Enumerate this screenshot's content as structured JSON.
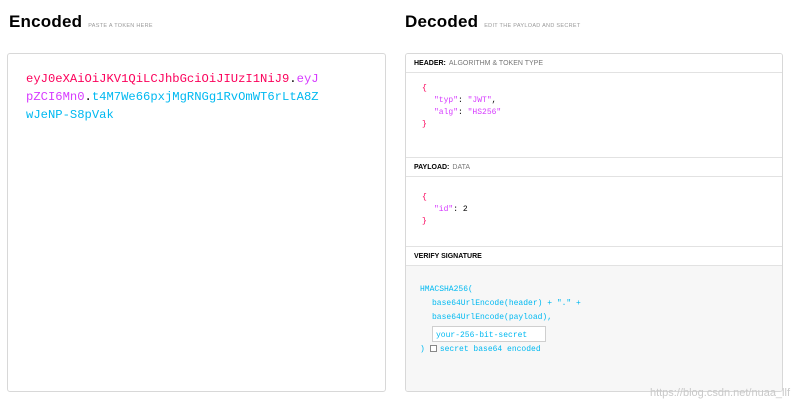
{
  "encoded": {
    "title": "Encoded",
    "subtitle": "PASTE A TOKEN HERE",
    "token_line1_header": "eyJ0eXAiOiJKV1QiLCJhbGciOiJIUzI1NiJ9",
    "token_line1_dot": ".",
    "token_line1_payload": "eyJ",
    "token_line2_payload": "pZCI6Mn0",
    "token_line2_dot": ".",
    "token_line2_sig": "t4M7We66pxjMgRNGg1RvOmWT6rLtA8Z",
    "token_line3_sig": "wJeNP-S8pVak"
  },
  "decoded": {
    "title": "Decoded",
    "subtitle": "EDIT THE PAYLOAD AND SECRET",
    "header": {
      "label": "HEADER:",
      "sub": "ALGORITHM & TOKEN TYPE",
      "open": "{",
      "k1": "\"typ\"",
      "v1": "\"JWT\"",
      "k2": "\"alg\"",
      "v2": "\"HS256\"",
      "close": "}"
    },
    "payload": {
      "label": "PAYLOAD:",
      "sub": "DATA",
      "open": "{",
      "k1": "\"id\"",
      "v1": "2",
      "close": "}"
    },
    "signature": {
      "label": "VERIFY SIGNATURE",
      "line1": "HMACSHA256(",
      "line2": "base64UrlEncode(header) + \".\" +",
      "line3": "base64UrlEncode(payload),",
      "secret_value": "your-256-bit-secret",
      "close": ")",
      "checkbox_label": "secret base64 encoded"
    }
  },
  "watermark": "https://blog.csdn.net/nuaa_llf",
  "colors": {
    "header": "#fb015b",
    "payload": "#d63aff",
    "signature": "#00b9f1"
  }
}
